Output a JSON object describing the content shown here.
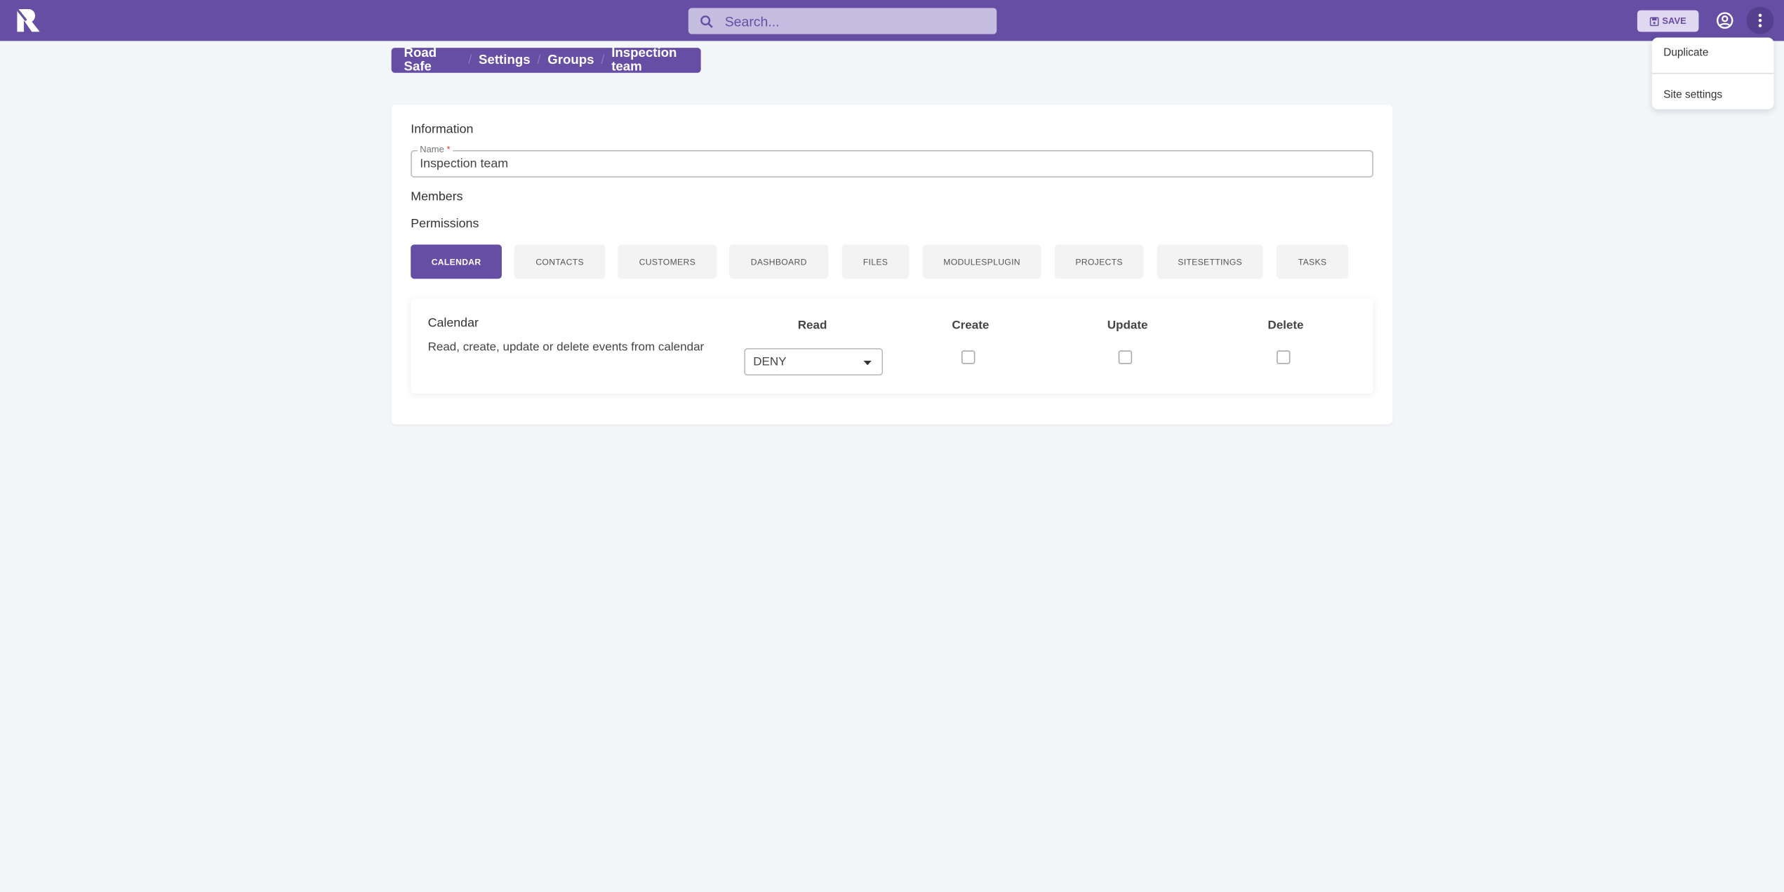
{
  "app": {
    "brand_color": "#654ea3",
    "logo": "R-logo"
  },
  "topbar": {
    "search_placeholder": "Search...",
    "save_label": "SAVE",
    "icons": [
      "search-icon",
      "save-icon",
      "account-icon",
      "more-vert-icon"
    ]
  },
  "menu": {
    "items": [
      {
        "label": "Duplicate"
      },
      {
        "label": "Site settings"
      }
    ]
  },
  "breadcrumb": [
    "Road Safe",
    "Settings",
    "Groups",
    "Inspection team"
  ],
  "form": {
    "information_title": "Information",
    "name_label": "Name",
    "name_required": "*",
    "name_value": "Inspection team",
    "members_title": "Members",
    "permissions_title": "Permissions"
  },
  "tabs": [
    {
      "label": "CALENDAR",
      "active": true
    },
    {
      "label": "CONTACTS"
    },
    {
      "label": "CUSTOMERS"
    },
    {
      "label": "DASHBOARD"
    },
    {
      "label": "FILES"
    },
    {
      "label": "MODULESPLUGIN"
    },
    {
      "label": "PROJECTS"
    },
    {
      "label": "SITESETTINGS"
    },
    {
      "label": "TASKS"
    }
  ],
  "permission": {
    "title": "Calendar",
    "description": "Read, create, update or delete events from calendar",
    "columns": {
      "read": "Read",
      "create": "Create",
      "update": "Update",
      "delete": "Delete"
    },
    "read_value": "DENY",
    "create": false,
    "update": false,
    "delete": false
  }
}
